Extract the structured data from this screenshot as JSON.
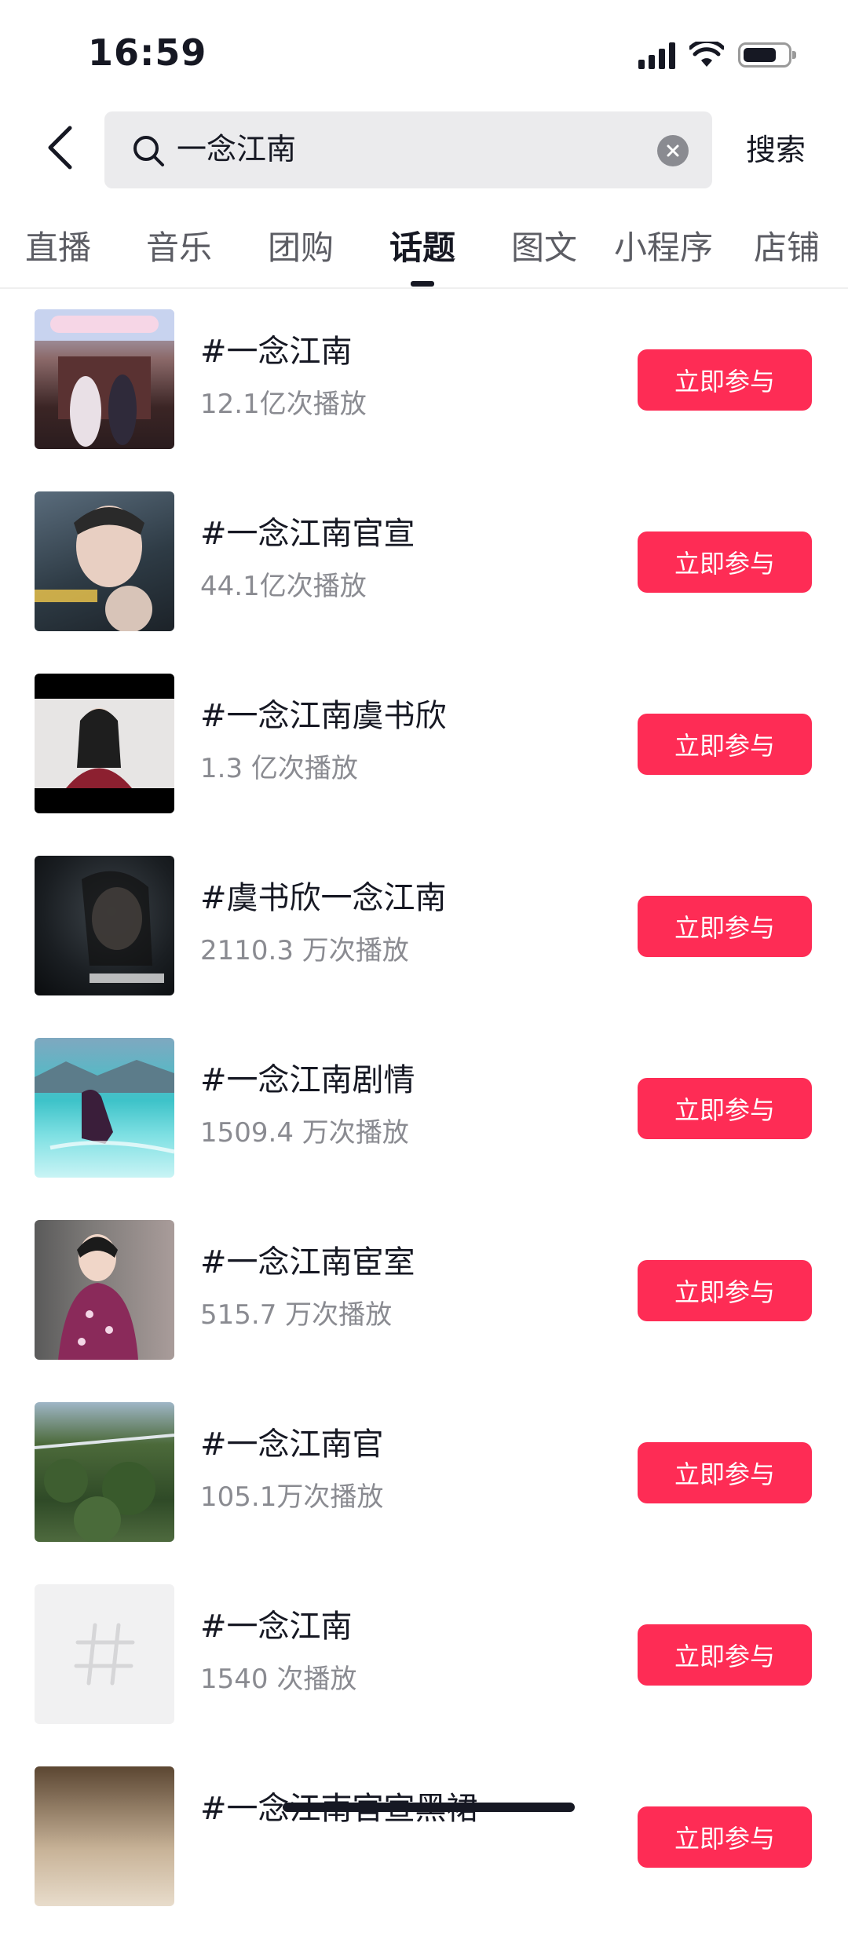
{
  "status_bar": {
    "time": "16:59",
    "battery_level": 0.75
  },
  "search": {
    "query": "一念江南",
    "submit_label": "搜索"
  },
  "tabs": [
    {
      "label": "直播",
      "active": false
    },
    {
      "label": "音乐",
      "active": false
    },
    {
      "label": "团购",
      "active": false
    },
    {
      "label": "话题",
      "active": true
    },
    {
      "label": "图文",
      "active": false
    },
    {
      "label": "小程序",
      "active": false
    },
    {
      "label": "店铺",
      "active": false
    }
  ],
  "topics": [
    {
      "name": "#一念江南",
      "plays": "12.1亿次播放",
      "button": "立即参与"
    },
    {
      "name": "#一念江南官宣",
      "plays": "44.1亿次播放",
      "button": "立即参与"
    },
    {
      "name": "#一念江南虞书欣",
      "plays": "1.3 亿次播放",
      "button": "立即参与"
    },
    {
      "name": "#虞书欣一念江南",
      "plays": "2110.3 万次播放",
      "button": "立即参与"
    },
    {
      "name": "#一念江南剧情",
      "plays": "1509.4 万次播放",
      "button": "立即参与"
    },
    {
      "name": "#一念江南宦室",
      "plays": "515.7 万次播放",
      "button": "立即参与"
    },
    {
      "name": "#一念江南官",
      "plays": "105.1万次播放",
      "button": "立即参与"
    },
    {
      "name": "#一念江南",
      "plays": "1540 次播放",
      "button": "立即参与"
    },
    {
      "name": "#一念江南官宣黑裙",
      "plays": "",
      "button": "立即参与"
    }
  ],
  "colors": {
    "accent": "#fe2c55",
    "text_primary": "#161823",
    "text_secondary": "#8a8b91"
  }
}
